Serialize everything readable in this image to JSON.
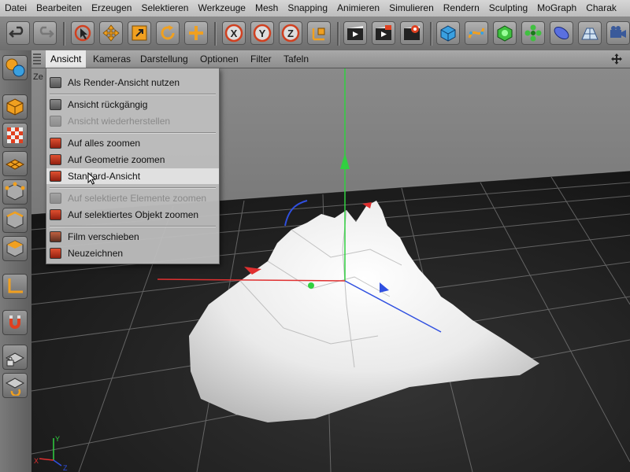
{
  "menubar": {
    "items": [
      "Datei",
      "Bearbeiten",
      "Erzeugen",
      "Selektieren",
      "Werkzeuge",
      "Mesh",
      "Snapping",
      "Animieren",
      "Simulieren",
      "Rendern",
      "Sculpting",
      "MoGraph",
      "Charak"
    ]
  },
  "toolbar": {
    "undo_icon": "undo-icon",
    "redo_icon": "redo-icon",
    "tools": [
      "live-selection-icon",
      "move-icon",
      "scale-icon",
      "rotate-icon",
      "add-icon"
    ],
    "axis_labels": [
      "X",
      "Y",
      "Z"
    ],
    "render_icons": [
      "render-view-icon",
      "render-picture-viewer-icon",
      "render-settings-icon"
    ],
    "object_icons": [
      "cube-icon",
      "spline-icon",
      "nurbs-icon",
      "array-icon",
      "deformer-icon",
      "floor-icon",
      "camera-icon"
    ]
  },
  "view_menu": {
    "items": [
      "Ansicht",
      "Kameras",
      "Darstellung",
      "Optionen",
      "Filter",
      "Tafeln"
    ],
    "active": "Ansicht"
  },
  "dropdown": {
    "items": [
      {
        "label": "Als Render-Ansicht nutzen",
        "enabled": true
      },
      {
        "label": "Ansicht rückgängig",
        "enabled": true
      },
      {
        "label": "Ansicht wiederherstellen",
        "enabled": false
      },
      {
        "label": "Auf alles zoomen",
        "enabled": true
      },
      {
        "label": "Auf Geometrie zoomen",
        "enabled": true
      },
      {
        "label": "Standard-Ansicht",
        "enabled": true,
        "highlighted": true
      },
      {
        "label": "Auf selektierte Elemente zoomen",
        "enabled": false
      },
      {
        "label": "Auf selektiertes Objekt zoomen",
        "enabled": true
      },
      {
        "label": "Film verschieben",
        "enabled": true
      },
      {
        "label": "Neuzeichnen",
        "enabled": true
      }
    ]
  },
  "viewport": {
    "label_partial": "Ze",
    "axis_gizmo": {
      "x": "X",
      "y": "Y",
      "z": "Z"
    }
  },
  "colors": {
    "x_axis": "#e03030",
    "y_axis": "#30d040",
    "z_axis": "#3050e0",
    "accent": "#e87a20"
  }
}
